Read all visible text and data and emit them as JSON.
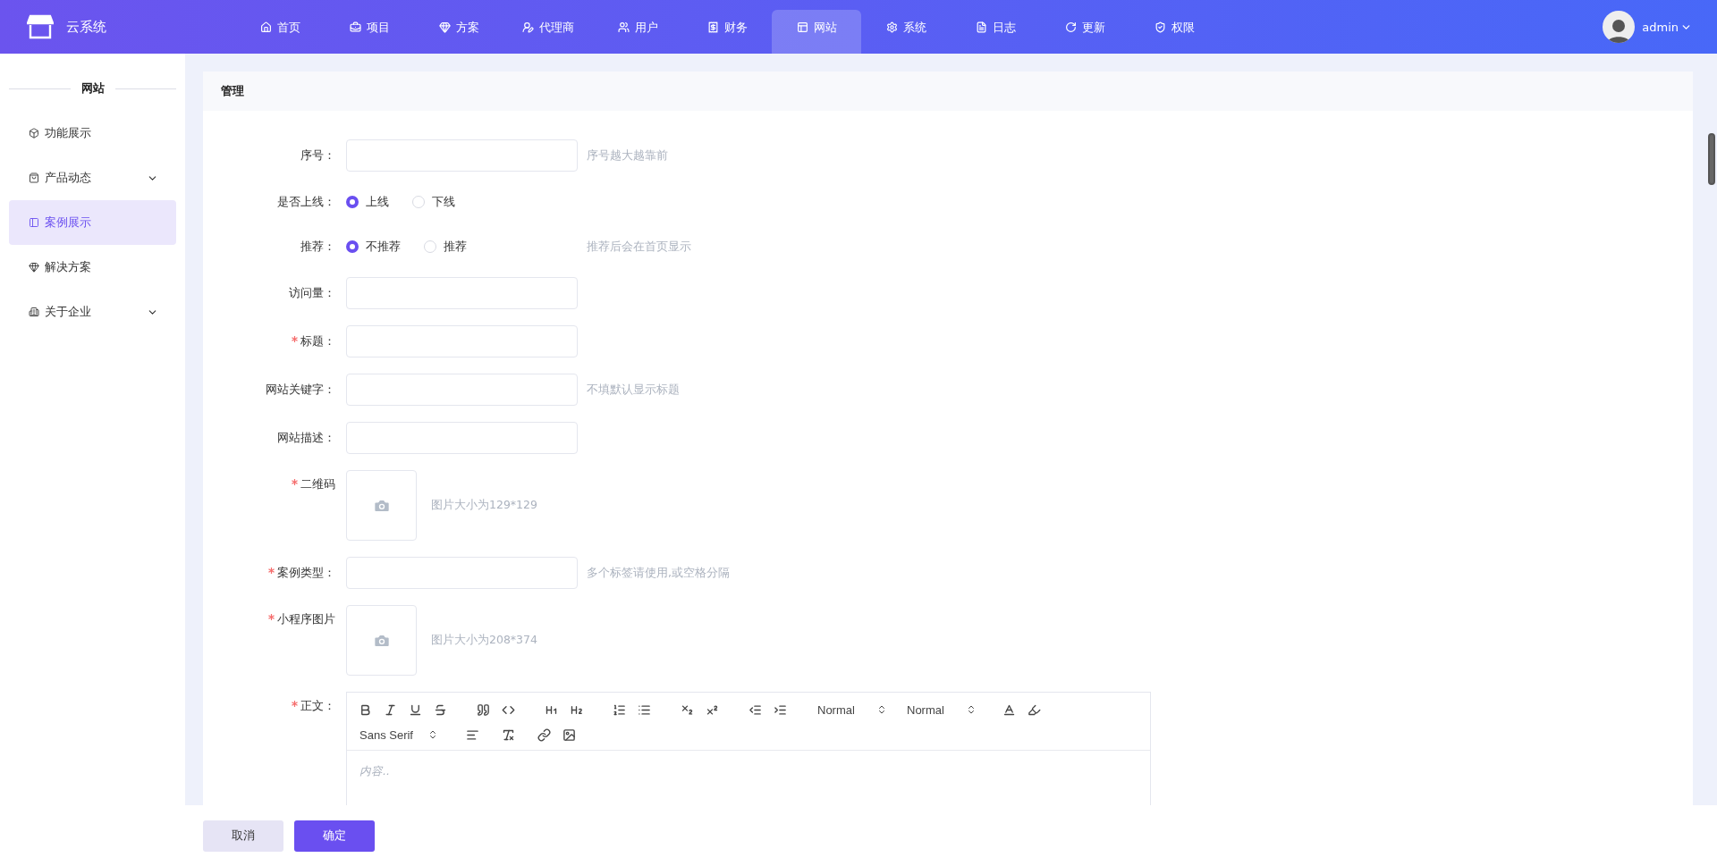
{
  "app": {
    "name": "云系统"
  },
  "nav": [
    {
      "label": "首页",
      "selected": false
    },
    {
      "label": "项目",
      "selected": false
    },
    {
      "label": "方案",
      "selected": false
    },
    {
      "label": "代理商",
      "selected": false
    },
    {
      "label": "用户",
      "selected": false
    },
    {
      "label": "财务",
      "selected": false
    },
    {
      "label": "网站",
      "selected": true
    },
    {
      "label": "系统",
      "selected": false
    },
    {
      "label": "日志",
      "selected": false
    },
    {
      "label": "更新",
      "selected": false
    },
    {
      "label": "权限",
      "selected": false
    }
  ],
  "user": {
    "name": "admin"
  },
  "sidebar": {
    "title": "网站",
    "items": [
      {
        "label": "功能展示",
        "kind": "link",
        "selected": false
      },
      {
        "label": "产品动态",
        "kind": "group",
        "expanded": false,
        "selected": false
      },
      {
        "label": "案例展示",
        "kind": "link",
        "selected": true
      },
      {
        "label": "解决方案",
        "kind": "link",
        "selected": false
      },
      {
        "label": "关于企业",
        "kind": "group",
        "expanded": false,
        "selected": false
      }
    ]
  },
  "panel": {
    "title": "管理"
  },
  "form": {
    "fields": [
      {
        "kind": "text",
        "label": "序号：",
        "required": false,
        "hint": "序号越大越靠前"
      },
      {
        "kind": "radio",
        "label": "是否上线：",
        "required": false,
        "options": [
          {
            "label": "上线",
            "selected": true
          },
          {
            "label": "下线",
            "selected": false
          }
        ]
      },
      {
        "kind": "radio",
        "label": "推荐：",
        "required": false,
        "options": [
          {
            "label": "不推荐",
            "selected": true
          },
          {
            "label": "推荐",
            "selected": false
          }
        ],
        "hint": "推荐后会在首页显示"
      },
      {
        "kind": "text",
        "label": "访问量：",
        "required": false
      },
      {
        "kind": "text",
        "label": "标题：",
        "required": true
      },
      {
        "kind": "text",
        "label": "网站关键字：",
        "required": false,
        "hint": "不填默认显示标题"
      },
      {
        "kind": "text",
        "label": "网站描述：",
        "required": false
      },
      {
        "kind": "upload",
        "label": "二维码",
        "required": true,
        "hint": "图片大小为129*129"
      },
      {
        "kind": "text",
        "label": "案例类型：",
        "required": true,
        "hint": "多个标签请使用,或空格分隔"
      },
      {
        "kind": "upload",
        "label": "小程序图片",
        "required": true,
        "hint": "图片大小为208*374"
      },
      {
        "kind": "editor",
        "label": "正文：",
        "required": true,
        "placeholder": "内容..",
        "selects": [
          "Normal",
          "Normal",
          "Sans Serif"
        ]
      }
    ]
  },
  "actions": [
    {
      "label": "取消",
      "kind": "secondary"
    },
    {
      "label": "确定",
      "kind": "primary"
    }
  ]
}
